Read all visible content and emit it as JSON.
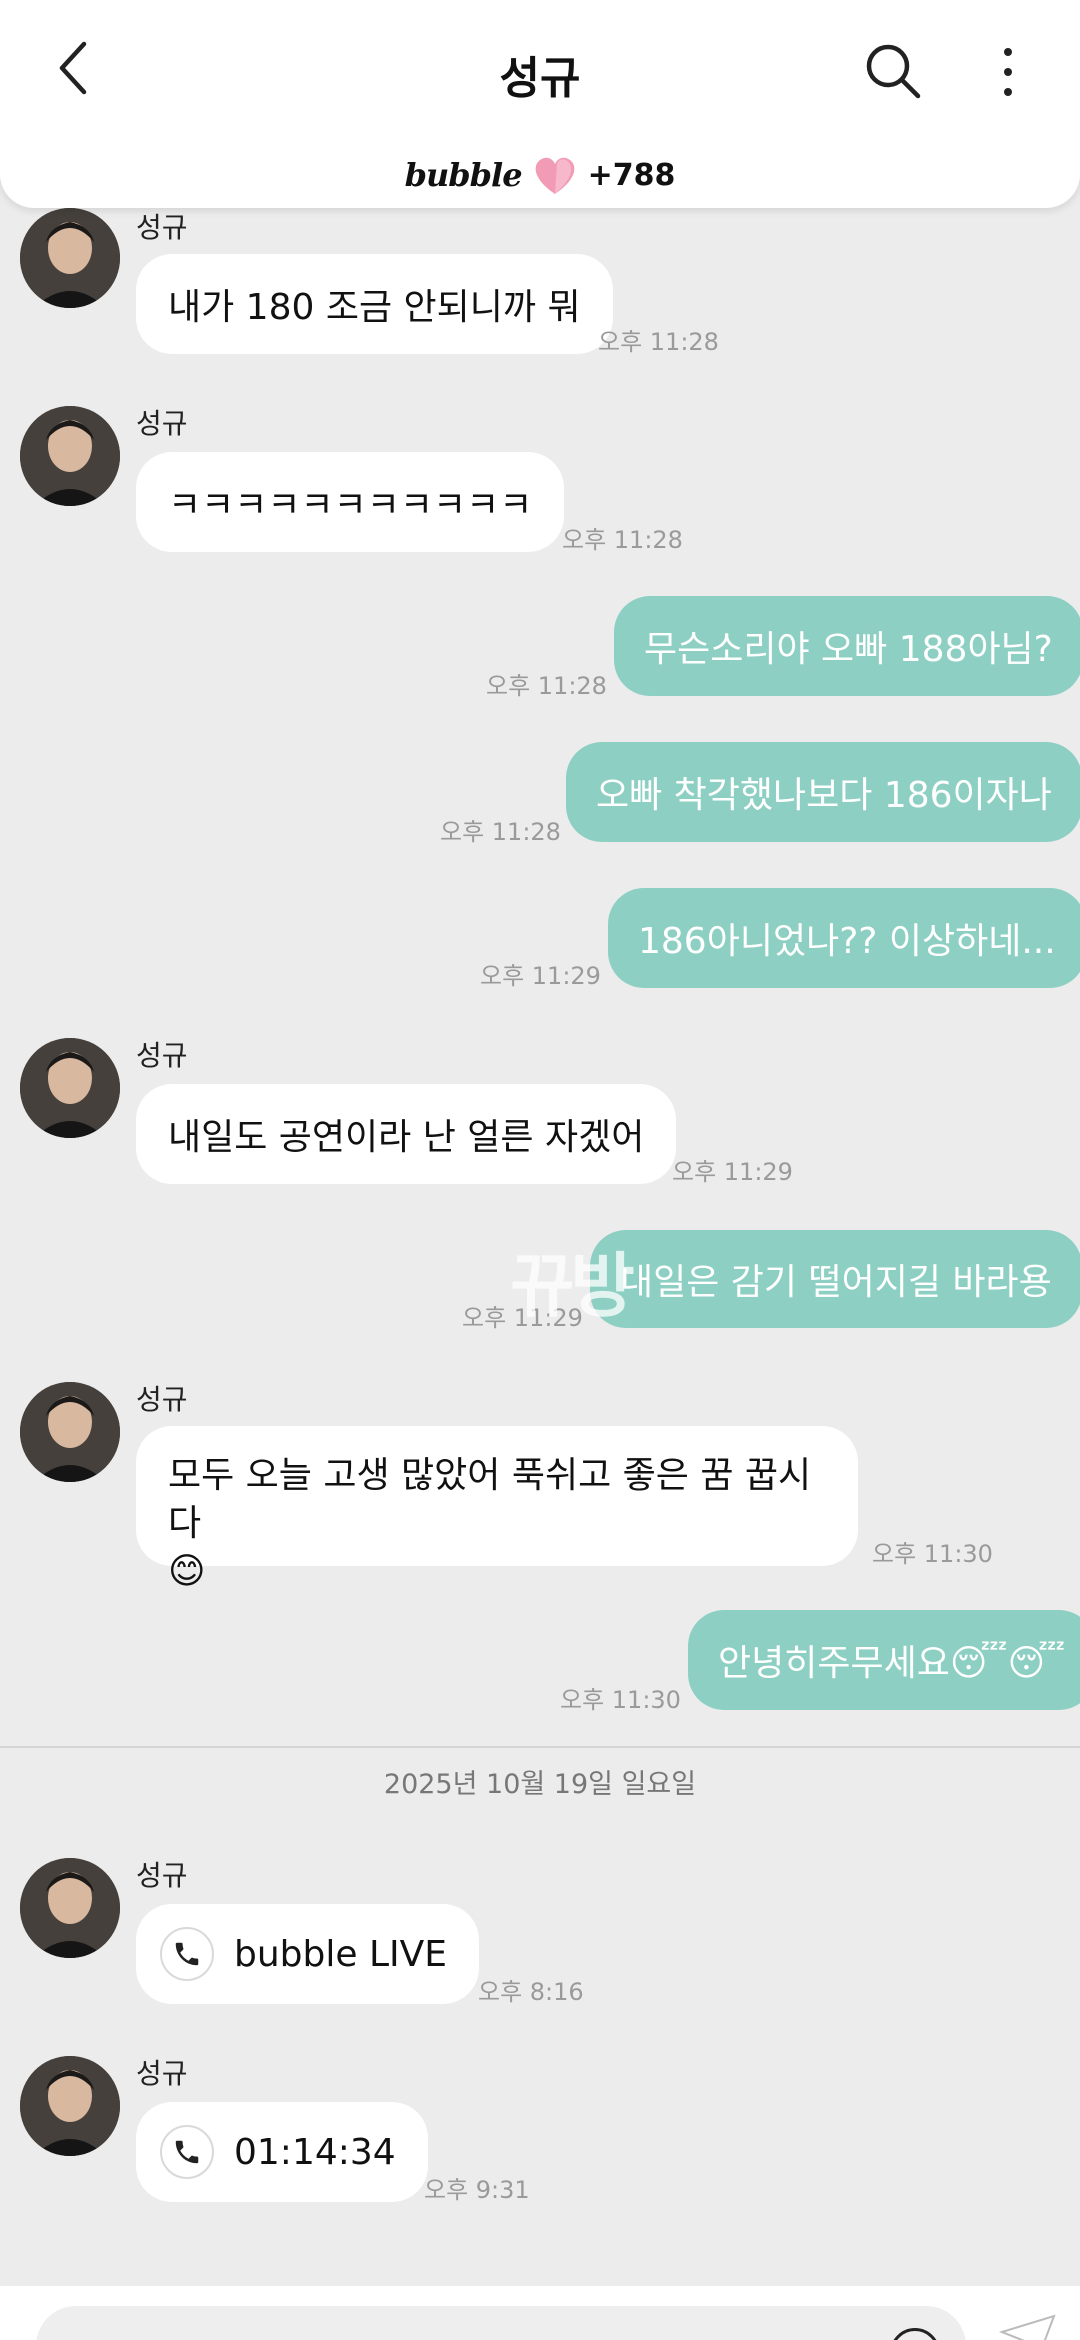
{
  "header": {
    "title": "성규",
    "bubble_logo": "bubble",
    "bubble_count": "+788"
  },
  "messages": [
    {
      "sender": "성규",
      "text": "내가 180 조금 안되니까 뭐",
      "time": "오후 11:28"
    },
    {
      "sender": "성규",
      "text": "ㅋㅋㅋㅋㅋㅋㅋㅋㅋㅋㅋ",
      "time": "오후 11:28"
    },
    {
      "text": "무슨소리야 오빠 188아님?",
      "time": "오후 11:28"
    },
    {
      "text": "오빠 착각했나보다 186이자나",
      "time": "오후 11:28"
    },
    {
      "text": "186아니었나?? 이상하네...",
      "time": "오후 11:29"
    },
    {
      "sender": "성규",
      "text": "내일도 공연이라 난 얼른 자겠어",
      "time": "오후 11:29"
    },
    {
      "text": "내일은 감기 떨어지길 바라용",
      "time": "오후 11:29"
    },
    {
      "sender": "성규",
      "text": "모두 오늘 고생 많았어 푹쉬고 좋은 꿈 꿉시다",
      "emoji": "😊",
      "time": "오후 11:30"
    },
    {
      "text": "안녕히주무세요😴😴",
      "time": "오후 11:30"
    },
    {
      "sender": "성규",
      "text": "bubble LIVE",
      "time": "오후 8:16"
    },
    {
      "sender": "성규",
      "text": "01:14:34",
      "time": "오후 9:31"
    }
  ],
  "watermark": "뀨방",
  "date_divider": "2025년 10월 19일 일요일",
  "colors": {
    "outgoing_bubble": "#8dd0c3",
    "incoming_bubble": "#ffffff",
    "background": "#ececec",
    "heart": "#f29bb5"
  },
  "icons": [
    "back-arrow-icon",
    "search-icon",
    "more-vertical-icon",
    "heart-icon",
    "phone-icon",
    "emoji-icon",
    "send-icon"
  ]
}
